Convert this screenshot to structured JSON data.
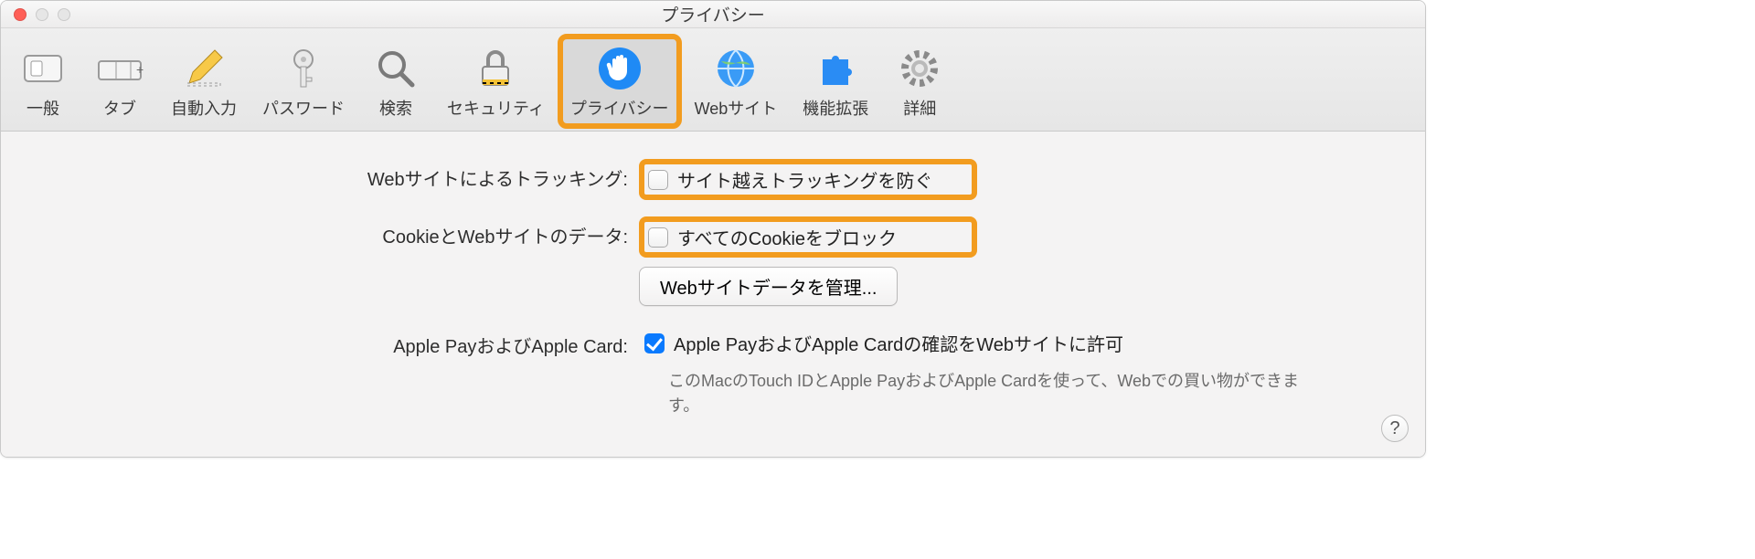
{
  "window": {
    "title": "プライバシー"
  },
  "toolbar": [
    {
      "id": "general",
      "label": "一般",
      "active": false
    },
    {
      "id": "tabs",
      "label": "タブ",
      "active": false
    },
    {
      "id": "autofill",
      "label": "自動入力",
      "active": false
    },
    {
      "id": "passwords",
      "label": "パスワード",
      "active": false
    },
    {
      "id": "search",
      "label": "検索",
      "active": false
    },
    {
      "id": "security",
      "label": "セキュリティ",
      "active": false
    },
    {
      "id": "privacy",
      "label": "プライバシー",
      "active": true,
      "highlight": true
    },
    {
      "id": "websites",
      "label": "Webサイト",
      "active": false
    },
    {
      "id": "extensions",
      "label": "機能拡張",
      "active": false
    },
    {
      "id": "advanced",
      "label": "詳細",
      "active": false
    }
  ],
  "rows": {
    "tracking": {
      "label": "Webサイトによるトラッキング:",
      "checkbox_label": "サイト越えトラッキングを防ぐ",
      "checked": false,
      "highlighted": true
    },
    "cookies": {
      "label": "CookieとWebサイトのデータ:",
      "checkbox_label": "すべてのCookieをブロック",
      "checked": false,
      "highlighted": true,
      "manage_button": "Webサイトデータを管理..."
    },
    "applepay": {
      "label": "Apple PayおよびApple Card:",
      "checkbox_label": "Apple PayおよびApple Cardの確認をWebサイトに許可",
      "checked": true,
      "description": "このMacのTouch IDとApple PayおよびApple Cardを使って、Webでの買い物ができます。"
    }
  },
  "help_label": "?"
}
